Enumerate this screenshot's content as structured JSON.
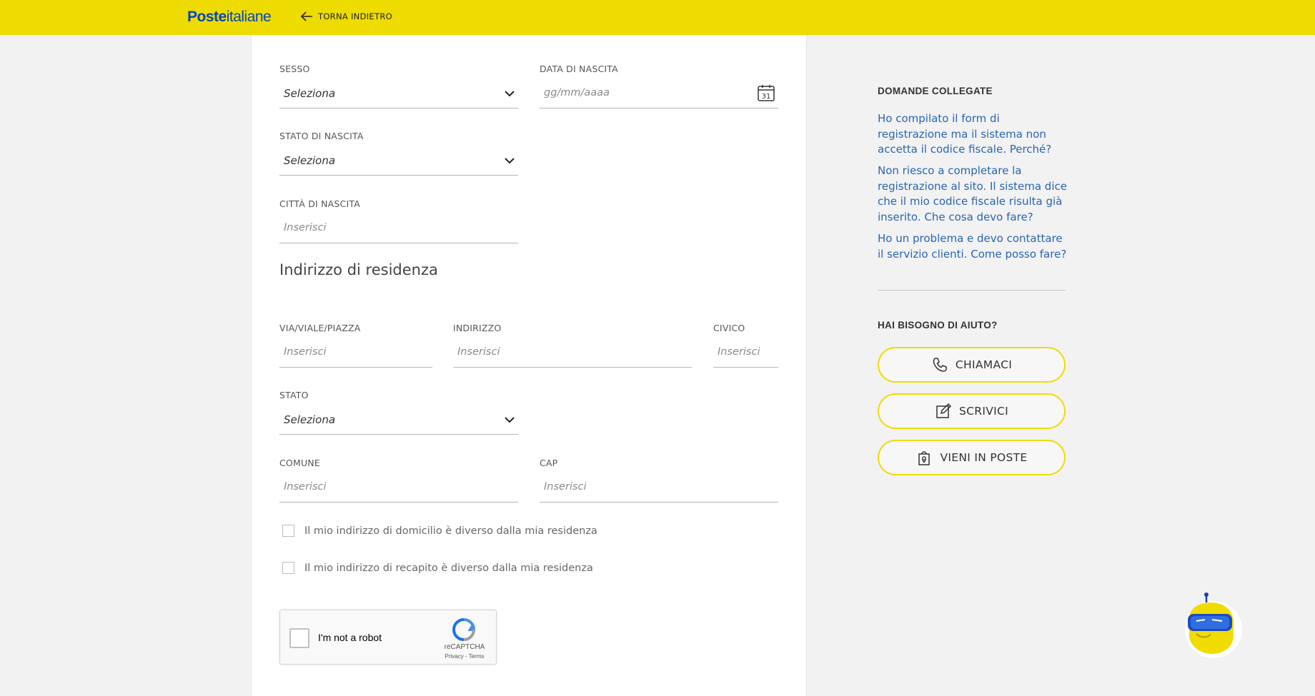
{
  "header": {
    "logo_bold": "Poste",
    "logo_light": "italiane",
    "back_label": "TORNA INDIETRO"
  },
  "form": {
    "sesso": {
      "label": "SESSO",
      "value": "Seleziona"
    },
    "data_nascita": {
      "label": "DATA DI NASCITA",
      "placeholder": "gg/mm/aaaa",
      "calendar_day": "31"
    },
    "stato_nascita": {
      "label": "STATO DI NASCITA",
      "value": "Seleziona"
    },
    "citta_nascita": {
      "label": "CITTÀ DI NASCITA",
      "placeholder": "Inserisci"
    },
    "section_title": "Indirizzo di residenza",
    "via": {
      "label": "VIA/VIALE/PIAZZA",
      "placeholder": "Inserisci"
    },
    "indirizzo": {
      "label": "INDIRIZZO",
      "placeholder": "Inserisci"
    },
    "civico": {
      "label": "CIVICO",
      "placeholder": "Inserisci"
    },
    "stato": {
      "label": "STATO",
      "value": "Seleziona"
    },
    "comune": {
      "label": "COMUNE",
      "placeholder": "Inserisci"
    },
    "cap": {
      "label": "CAP",
      "placeholder": "Inserisci"
    },
    "checkbox_domicilio": "Il mio indirizzo di domicilio è diverso dalla mia residenza",
    "checkbox_recapito": "Il mio indirizzo di recapito è diverso dalla mia residenza"
  },
  "recaptcha": {
    "label": "I'm not a robot",
    "brand": "reCAPTCHA",
    "links": "Privacy - Terms"
  },
  "sidebar": {
    "related_title": "DOMANDE COLLEGATE",
    "questions": [
      "Ho compilato il form di registrazione ma il sistema non accetta il codice fiscale. Perché?",
      "Non riesco a completare la registrazione al sito. Il sistema dice che il mio codice fiscale risulta già inserito. Che cosa devo fare?",
      "Ho un problema e devo contattare il servizio clienti. Come posso fare?"
    ],
    "help_title": "HAI BISOGNO DI AIUTO?",
    "buttons": {
      "call": "CHIAMACI",
      "write": "SCRIVICI",
      "visit": "VIENI IN POSTE"
    }
  },
  "colors": {
    "brand_yellow": "#eedc00",
    "brand_blue": "#0047bb",
    "link_blue": "#2966b0"
  }
}
